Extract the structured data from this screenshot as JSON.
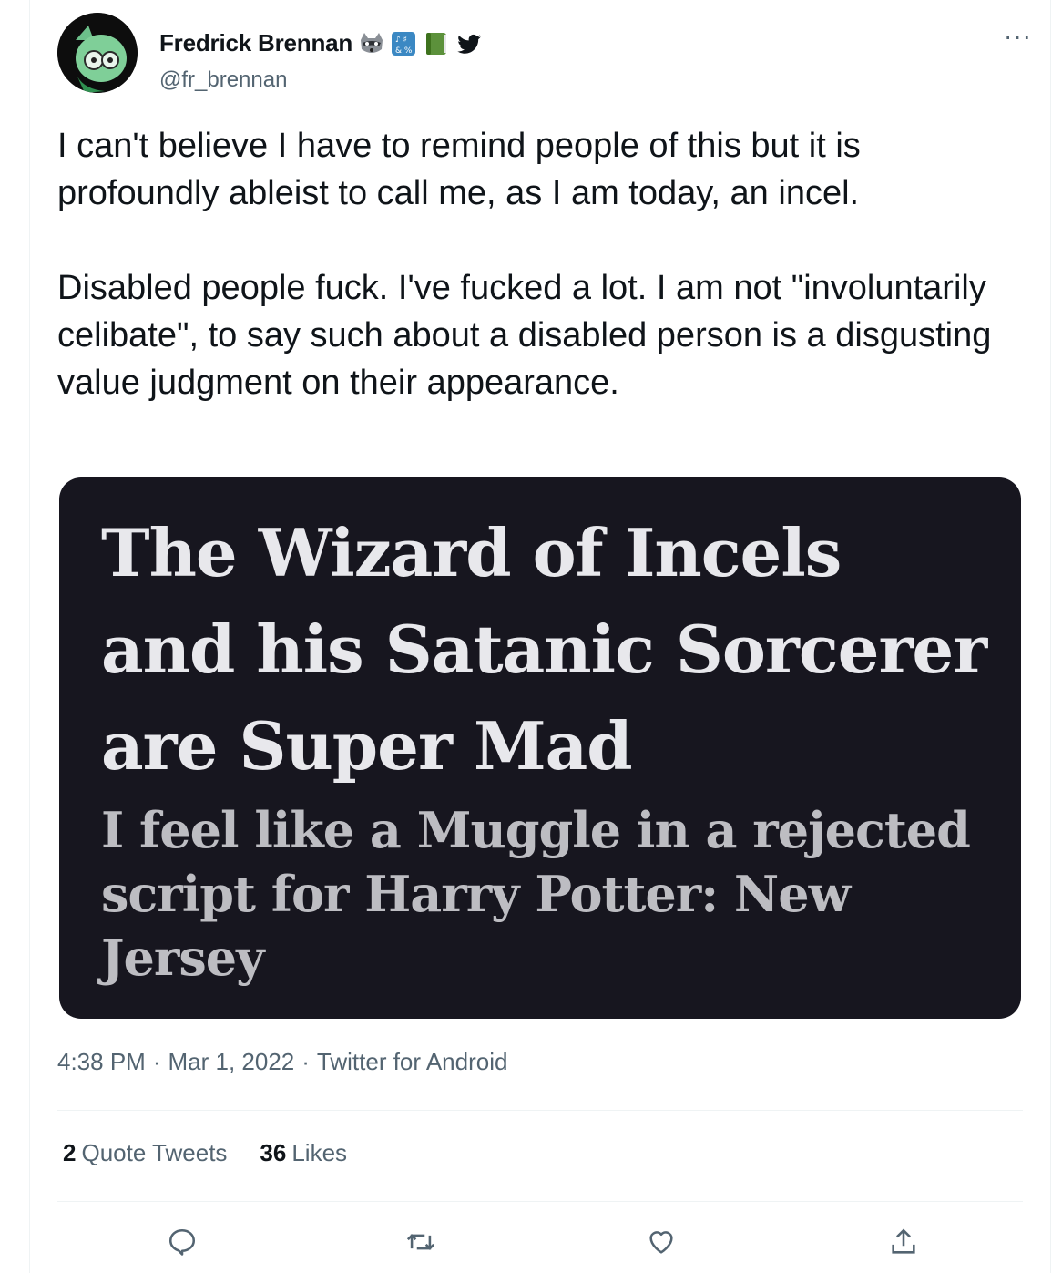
{
  "user": {
    "display_name": "Fredrick Brennan",
    "handle": "@fr_brennan",
    "badge_icons": [
      "raccoon-icon",
      "input-symbols-icon",
      "green-book-icon",
      "twitter-bird-icon"
    ]
  },
  "tweet": {
    "text": "I can't believe I have to remind people of this but it is profoundly ableist to call me, as I am today, an incel.\n\nDisabled people fuck. I've fucked a lot. I am not \"involuntarily celibate\", to say such about a disabled person is a disgusting value judgment on their appearance."
  },
  "media": {
    "headline": "The Wizard of Incels and his Satanic Sorcerer are Super Mad",
    "subheadline": "I feel like a Muggle in a rejected script for Harry Potter: New Jersey",
    "background_color": "#17161f"
  },
  "meta": {
    "time": "4:38 PM",
    "separator": "·",
    "date": "Mar 1, 2022",
    "source": "Twitter for Android"
  },
  "stats": {
    "quote_count": "2",
    "quote_label": "Quote Tweets",
    "like_count": "36",
    "like_label": "Likes"
  },
  "actions": {
    "icons": [
      "reply-icon",
      "retweet-icon",
      "like-icon",
      "share-icon"
    ]
  },
  "colors": {
    "text_primary": "#0f1419",
    "text_secondary": "#536471",
    "divider": "#eff3f4"
  },
  "more_label": "···"
}
